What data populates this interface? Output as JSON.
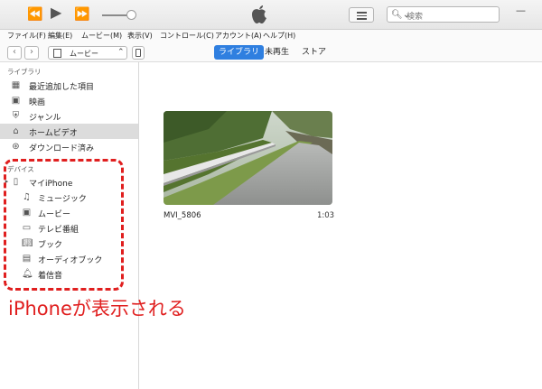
{
  "window": {
    "search_placeholder": "検索",
    "search_icon": "search-icon",
    "controls": {
      "minimize": "—",
      "maximize": "☐",
      "close": "✕"
    }
  },
  "menu": [
    "ファイル(F)",
    "編集(E)",
    "ムービー(M)",
    "表示(V)",
    "コントロール(C)",
    "アカウント(A)",
    "ヘルプ(H)"
  ],
  "nav": {
    "back": "‹",
    "forward": "›",
    "media_select": "ムービー",
    "tabs": [
      "ライブラリ",
      "未再生",
      "ストア"
    ],
    "active_tab": "ライブラリ"
  },
  "sidebar": {
    "library_header": "ライブラリ",
    "library_items": [
      {
        "label": "最近追加した項目",
        "icon": "calendar-grid-icon"
      },
      {
        "label": "映画",
        "icon": "film-icon"
      },
      {
        "label": "ジャンル",
        "icon": "genre-icon"
      },
      {
        "label": "ホームビデオ",
        "icon": "home-video-icon",
        "selected": true
      },
      {
        "label": "ダウンロード済み",
        "icon": "download-icon"
      }
    ],
    "devices_header": "デバイス",
    "device": {
      "label": "マイiPhone",
      "icon": "iphone-icon"
    },
    "device_items": [
      {
        "label": "ミュージック",
        "icon": "music-note-icon"
      },
      {
        "label": "ムービー",
        "icon": "film-icon"
      },
      {
        "label": "テレビ番組",
        "icon": "tv-icon"
      },
      {
        "label": "ブック",
        "icon": "book-icon"
      },
      {
        "label": "オーディオブック",
        "icon": "audiobook-icon"
      },
      {
        "label": "着信音",
        "icon": "bell-icon"
      }
    ]
  },
  "annotation": {
    "caption": "iPhoneが表示される",
    "color": "#e01f1f"
  },
  "content": {
    "video": {
      "title": "MVI_5806",
      "duration": "1:03"
    }
  },
  "colors": {
    "accent": "#2f7fe0",
    "selection": "#dcdcdc"
  }
}
